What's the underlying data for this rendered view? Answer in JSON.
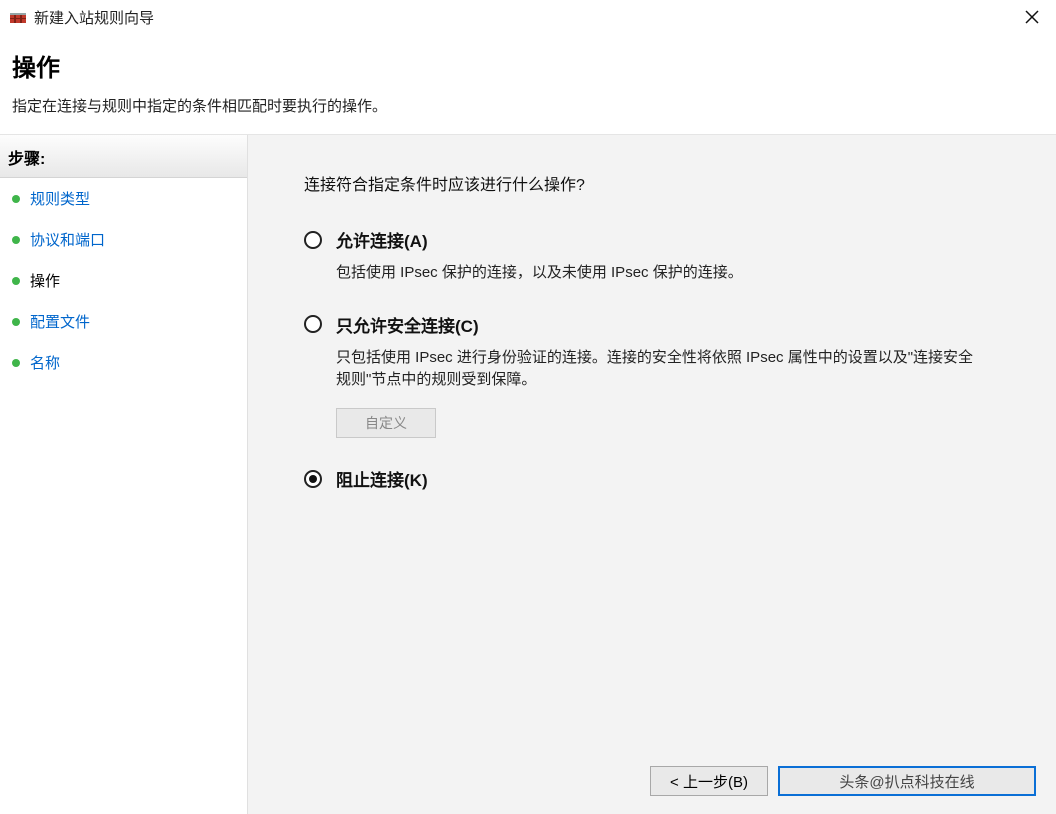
{
  "window": {
    "title": "新建入站规则向导"
  },
  "header": {
    "title": "操作",
    "subtitle": "指定在连接与规则中指定的条件相匹配时要执行的操作。"
  },
  "sidebar": {
    "title": "步骤:",
    "items": [
      {
        "label": "规则类型",
        "state": "link"
      },
      {
        "label": "协议和端口",
        "state": "link"
      },
      {
        "label": "操作",
        "state": "current"
      },
      {
        "label": "配置文件",
        "state": "link"
      },
      {
        "label": "名称",
        "state": "link"
      }
    ]
  },
  "main": {
    "prompt": "连接符合指定条件时应该进行什么操作?",
    "options": [
      {
        "label": "允许连接(A)",
        "desc": "包括使用 IPsec 保护的连接，以及未使用 IPsec 保护的连接。",
        "selected": false
      },
      {
        "label": "只允许安全连接(C)",
        "desc": "只包括使用 IPsec 进行身份验证的连接。连接的安全性将依照 IPsec 属性中的设置以及\"连接安全规则\"节点中的规则受到保障。",
        "selected": false,
        "customize": "自定义"
      },
      {
        "label": "阻止连接(K)",
        "desc": "",
        "selected": true
      }
    ]
  },
  "footer": {
    "back": "< 上一步(B)",
    "next_watermark": "头条@扒点科技在线"
  }
}
